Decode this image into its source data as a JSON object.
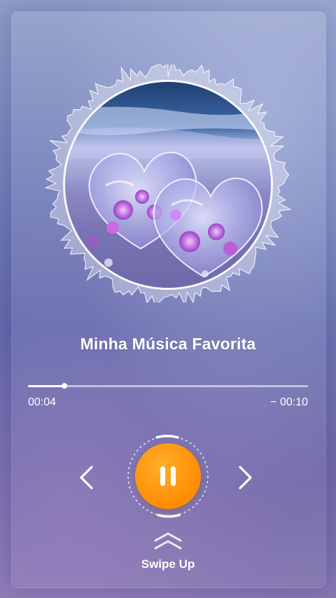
{
  "player": {
    "song_title": "Minha Música Favorita",
    "time_elapsed": "00:04",
    "time_remaining": "− 00:10",
    "progress_fraction": 0.13,
    "state": "playing",
    "album_art": "two-glass-hearts-with-purple-flowers-on-beach"
  },
  "controls": {
    "prev_icon": "chevron-left-icon",
    "pause_icon": "pause-icon",
    "next_icon": "chevron-right-icon",
    "accent_color": "#ff8c00"
  },
  "footer": {
    "swipe_icon": "double-chevron-up-icon",
    "swipe_label": "Swipe Up"
  }
}
